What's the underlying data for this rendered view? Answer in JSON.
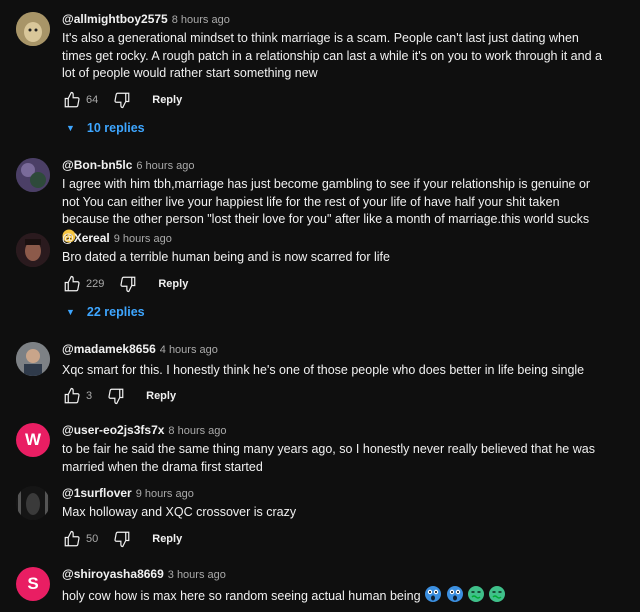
{
  "comments": [
    {
      "author": "@allmightboy2575",
      "time": "8 hours ago",
      "text": "It's also a generational mindset to think marriage is a scam. People can't last just dating when times get rocky. A rough patch in a relationship can last a while it's on you to work through it and a lot of people would rather start something new",
      "likes": "64",
      "reply_label": "Reply",
      "replies_label": "10 replies"
    },
    {
      "author": "@Bon-bn5lc",
      "time": "6 hours ago",
      "text": "I agree with him tbh,marriage has just become gambling to see if your relationship is genuine or not You can either live your happiest life for the rest of your life of have half your shit taken because the other person \"lost their love for you\" after like a month of marriage.this world sucks"
    },
    {
      "author": "@Xereal",
      "time": "9 hours ago",
      "text": "Bro dated a terrible human being and is now scarred for life",
      "likes": "229",
      "reply_label": "Reply",
      "replies_label": "22 replies"
    },
    {
      "author": "@madamek8656",
      "time": "4 hours ago",
      "text": "Xqc smart for this. I honestly think he's one of those people who does better in life being single",
      "likes": "3",
      "reply_label": "Reply"
    },
    {
      "author": "@user-eo2js3fs7x",
      "time": "8 hours ago",
      "avatar_letter": "W",
      "avatar_color": "#e91e63",
      "text": "to be fair he said the same thing many years ago, so I honestly never really believed that he was married when the drama first started"
    },
    {
      "author": "@1surflover",
      "time": "9 hours ago",
      "text": "Max holloway and XQC crossover is crazy",
      "likes": "50",
      "reply_label": "Reply"
    },
    {
      "author": "@shiroyasha8669",
      "time": "3 hours ago",
      "avatar_letter": "S",
      "avatar_color": "#e91e63",
      "text": "holy cow how is max here so random seeing actual human being"
    }
  ],
  "icons": {
    "like": "thumbs-up-icon",
    "dislike": "thumbs-down-icon",
    "expand": "caret-down-icon"
  },
  "colors": {
    "link": "#3ea6ff",
    "background": "#0f0f0f"
  }
}
